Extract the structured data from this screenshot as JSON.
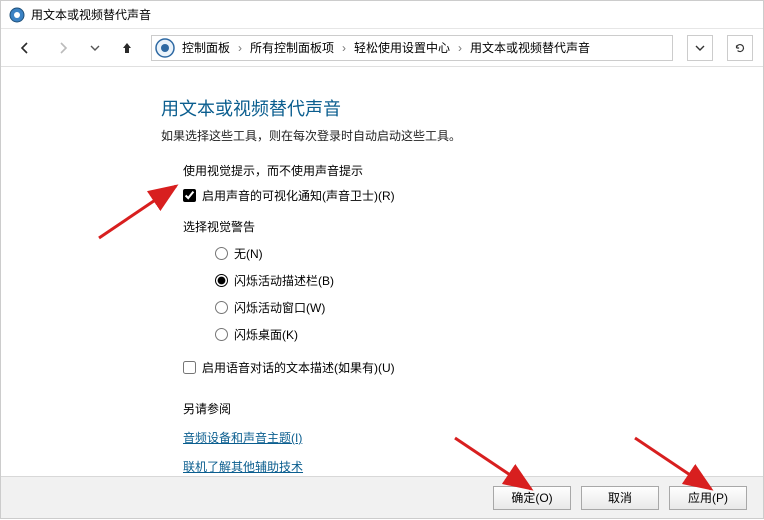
{
  "window": {
    "title": "用文本或视频替代声音"
  },
  "breadcrumbs": {
    "items": [
      "控制面板",
      "所有控制面板项",
      "轻松使用设置中心",
      "用文本或视频替代声音"
    ]
  },
  "page": {
    "title": "用文本或视频替代声音",
    "desc": "如果选择这些工具，则在每次登录时自动启动这些工具。",
    "visualHeading": "使用视觉提示，而不使用声音提示",
    "soundSentry": "启用声音的可视化通知(声音卫士)(R)",
    "chooseWarning": "选择视觉警告",
    "radios": {
      "none": "无(N)",
      "flashCaption": "闪烁活动描述栏(B)",
      "flashWindow": "闪烁活动窗口(W)",
      "flashDesktop": "闪烁桌面(K)"
    },
    "textCaption": "启用语音对话的文本描述(如果有)(U)",
    "seeAlso": "另请参阅",
    "linkAudio": "音频设备和声音主题(I)",
    "linkOnline": "联机了解其他辅助技术"
  },
  "buttons": {
    "ok": "确定(O)",
    "cancel": "取消",
    "apply": "应用(P)"
  }
}
